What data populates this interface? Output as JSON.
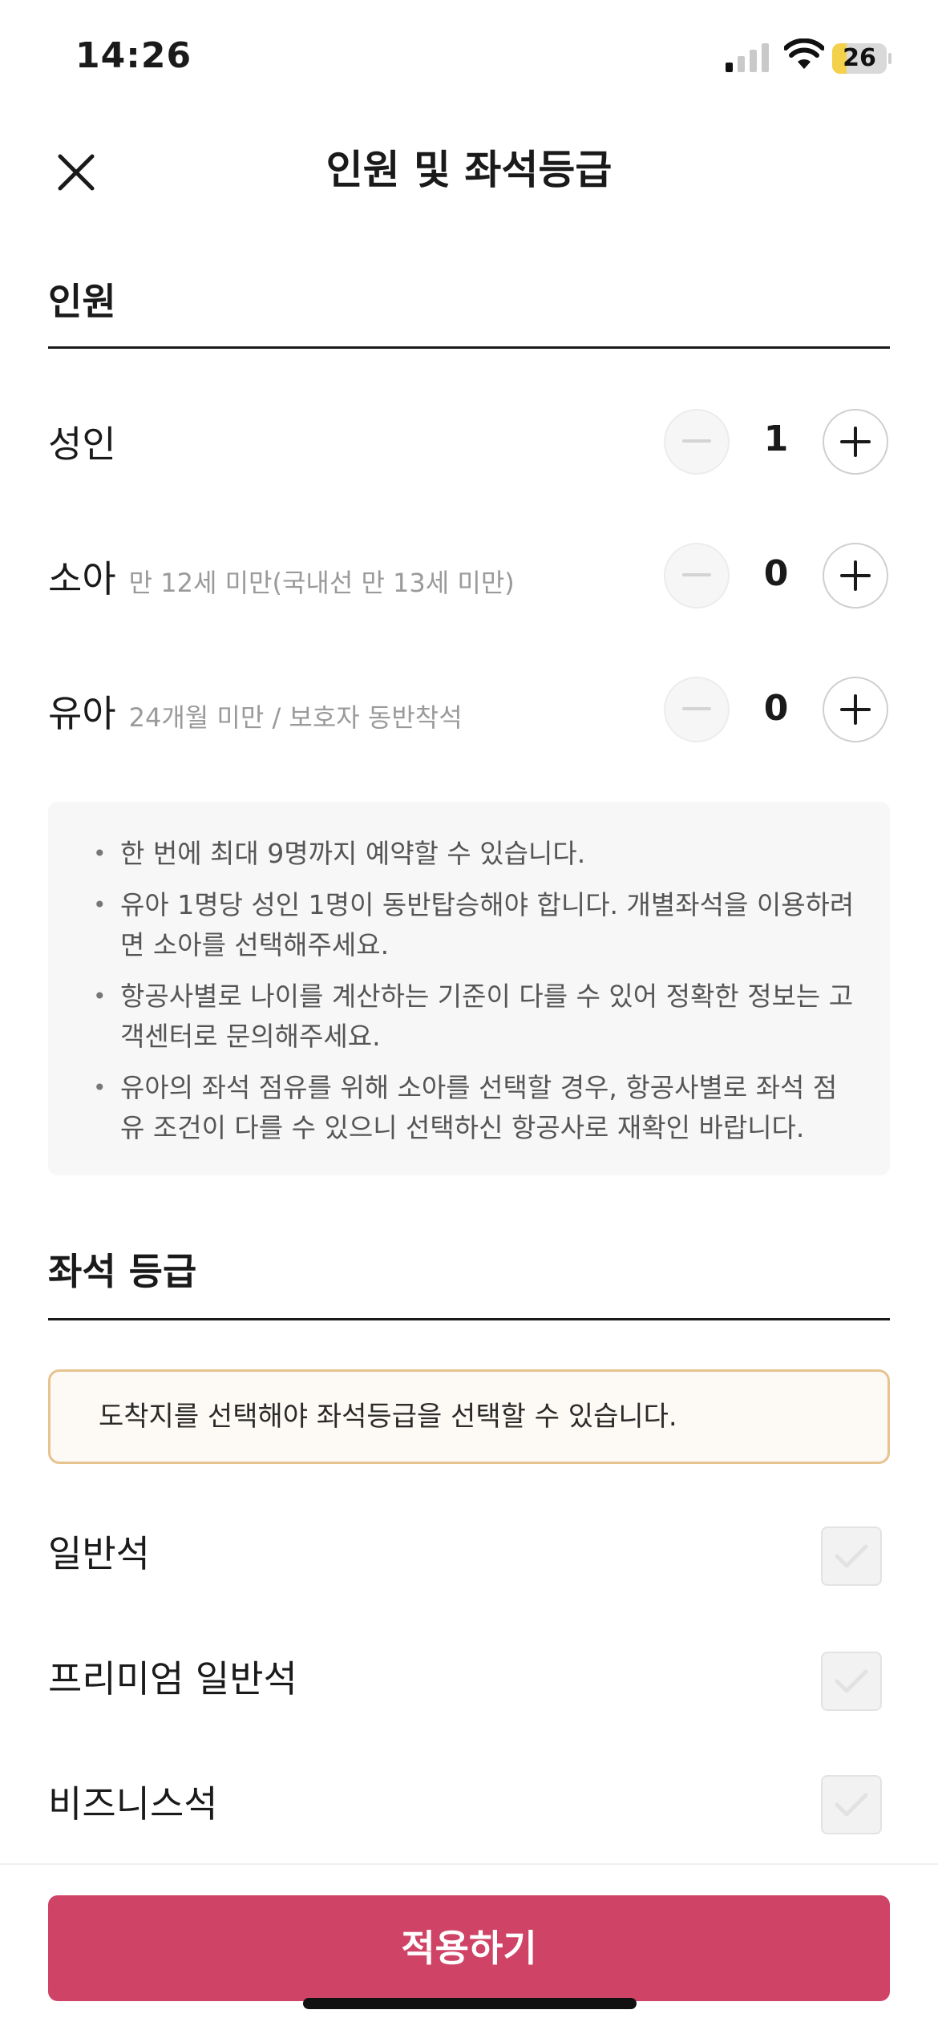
{
  "status_bar": {
    "time": "14:26",
    "battery_level": "26",
    "battery_fraction": 0.26,
    "battery_color": "#f3d14a"
  },
  "header": {
    "title": "인원 및 좌석등급",
    "close_icon": "close-icon"
  },
  "passengers": {
    "section_title": "인원",
    "rows": [
      {
        "label": "성인",
        "sub": "",
        "count": "1"
      },
      {
        "label": "소아",
        "sub": "만 12세 미만(국내선 만 13세 미만)",
        "count": "0"
      },
      {
        "label": "유아",
        "sub": "24개월 미만 / 보호자 동반착석",
        "count": "0"
      }
    ]
  },
  "notices": [
    "한 번에 최대 9명까지 예약할 수 있습니다.",
    "유아 1명당 성인 1명이 동반탑승해야 합니다. 개별좌석을 이용하려면 소아를 선택해주세요.",
    "항공사별로 나이를 계산하는 기준이 다를 수 있어 정확한 정보는 고객센터로 문의해주세요.",
    "유아의 좌석 점유를 위해 소아를 선택할 경우, 항공사별로 좌석 점유 조건이 다를 수 있으니 선택하신 항공사로 재확인 바랍니다."
  ],
  "seat_class": {
    "section_title": "좌석 등급",
    "warning": "도착지를 선택해야 좌석등급을 선택할 수 있습니다.",
    "options": [
      {
        "label": "일반석",
        "checked": false,
        "disabled": true
      },
      {
        "label": "프리미엄 일반석",
        "checked": false,
        "disabled": true
      },
      {
        "label": "비즈니스석",
        "checked": false,
        "disabled": true
      }
    ]
  },
  "footer": {
    "apply_label": "적용하기",
    "button_color": "#cf4466"
  }
}
